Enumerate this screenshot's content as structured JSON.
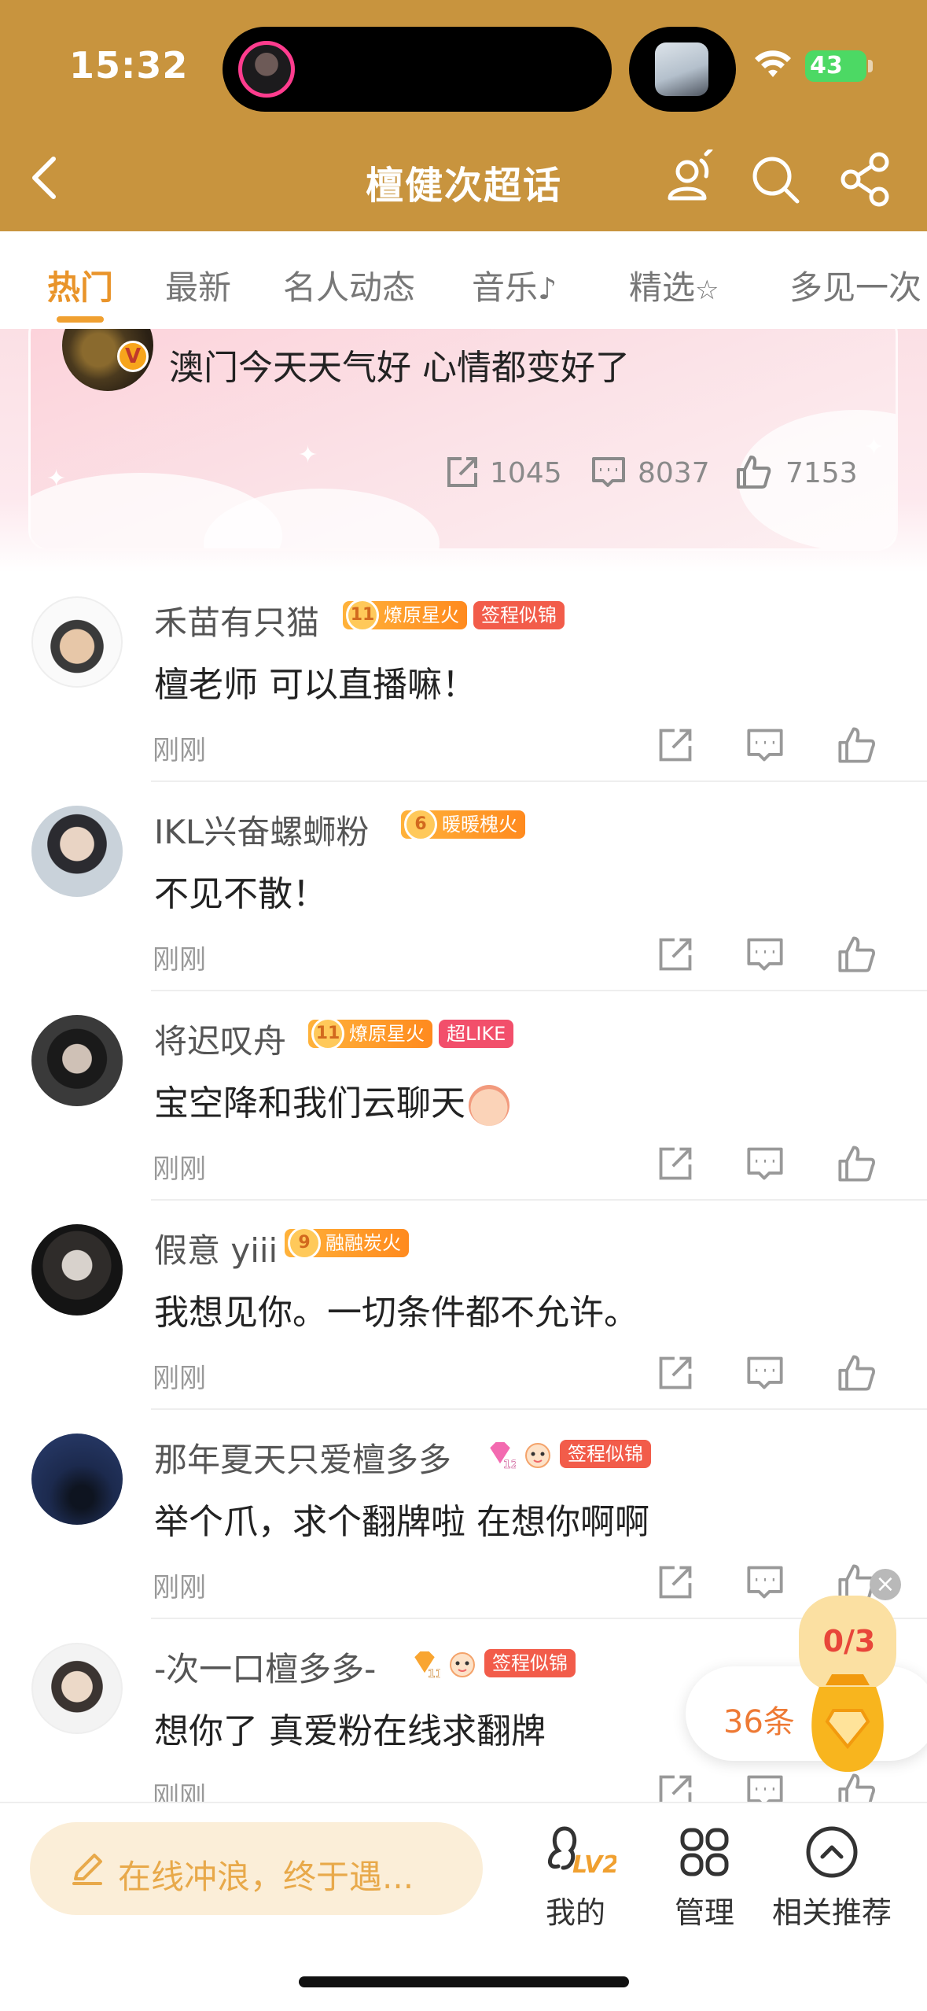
{
  "status_bar": {
    "time": "15:32",
    "battery": "43"
  },
  "header": {
    "title": "檀健次超话"
  },
  "tabs": [
    {
      "label": "热门",
      "active": true
    },
    {
      "label": "最新",
      "active": false
    },
    {
      "label": "名人动态",
      "active": false
    },
    {
      "label": "音乐",
      "active": false
    },
    {
      "label": "精选",
      "active": false
    },
    {
      "label": "多见一次",
      "active": false
    }
  ],
  "pinned_post": {
    "text": "澳门今天天气好 心情都变好了",
    "reposts": "1045",
    "comments": "8037",
    "likes": "7153"
  },
  "comments": [
    {
      "name": "禾苗有只猫",
      "badges": [
        {
          "kind": "level",
          "level": "11",
          "text": "燎原星火"
        },
        {
          "kind": "red",
          "text": "签程似锦"
        }
      ],
      "text": "檀老师 可以直播嘛！",
      "time": "刚刚"
    },
    {
      "name": "IKL兴奋螺蛳粉",
      "badges": [
        {
          "kind": "level",
          "level": "6",
          "text": "暖暖槐火"
        }
      ],
      "text": "不见不散！",
      "time": "刚刚"
    },
    {
      "name": "将迟叹舟",
      "badges": [
        {
          "kind": "level",
          "level": "11",
          "text": "燎原星火"
        },
        {
          "kind": "pink",
          "text": "超LIKE"
        }
      ],
      "text": "宝空降和我们云聊天",
      "time": "刚刚"
    },
    {
      "name": "假意 yiii",
      "badges": [
        {
          "kind": "level",
          "level": "9",
          "text": "融融炭火"
        }
      ],
      "text": "我想见你。一切条件都不允许。",
      "time": "刚刚"
    },
    {
      "name": "那年夏天只爱檀多多",
      "badges": [
        {
          "kind": "gem",
          "level": "12"
        },
        {
          "kind": "face"
        },
        {
          "kind": "red",
          "text": "签程似锦"
        }
      ],
      "text": "举个爪，求个翻牌啦 在想你啊啊",
      "time": "刚刚"
    },
    {
      "name": "-次一口檀多多-",
      "badges": [
        {
          "kind": "gem",
          "level": "11"
        },
        {
          "kind": "face"
        },
        {
          "kind": "red",
          "text": "签程似锦"
        }
      ],
      "text": "想你了 真爱粉在线求翻牌",
      "time": "刚刚"
    }
  ],
  "floating_widget": {
    "progress": "0/3",
    "count": "36条"
  },
  "bottom_bar": {
    "compose_placeholder": "在线冲浪，终于遇...",
    "level_badge": "LV2",
    "nav": [
      {
        "label": "我的"
      },
      {
        "label": "管理"
      },
      {
        "label": "相关推荐"
      }
    ]
  },
  "colors": {
    "header_bg": "#c8943e",
    "accent_orange": "#e9942a",
    "card_pink": "#fbe0e5"
  }
}
